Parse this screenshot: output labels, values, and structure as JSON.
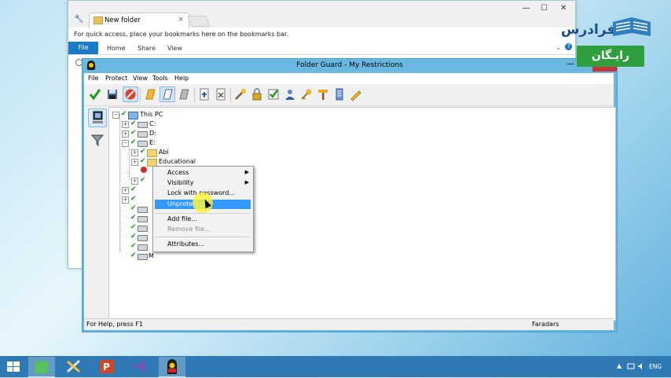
{
  "explorer": {
    "tab_label": "New folder",
    "tab_close": "×",
    "bookmark_bar_text": "For quick access, place your bookmarks here on the bookmarks bar.",
    "ribbon": {
      "file": "File",
      "tabs": [
        "Home",
        "Share",
        "View"
      ]
    },
    "controls": {
      "minimize": "—",
      "maximize": "☐",
      "close": "✕"
    }
  },
  "folder_guard": {
    "title": "Folder Guard - My Restrictions",
    "close": "✕",
    "menu": [
      "File",
      "Protect",
      "View",
      "Tools",
      "Help"
    ],
    "tree": {
      "root": "This PC",
      "drives": [
        "C:",
        "D:",
        "E:"
      ],
      "e_children": [
        "Abi",
        "Educational"
      ],
      "last_partial": "M"
    },
    "context_menu": {
      "items": [
        {
          "label": "Access",
          "submenu": true
        },
        {
          "label": "Visibility",
          "submenu": true
        },
        {
          "label": "Lock with password..."
        },
        {
          "label": "Unprotect..."
        },
        {
          "label": "Add file..."
        },
        {
          "label": "Remove file...",
          "disabled": true
        },
        {
          "label": "Attributes..."
        }
      ],
      "highlighted": "Unprotect..."
    },
    "status": {
      "help": "For Help, press F1",
      "user": "Faradars"
    }
  },
  "brand": {
    "name": "فرادرس",
    "tagline": "رایـگان",
    "accent": "#2e9e3f",
    "logo_color": "#1a4f8a"
  },
  "taskbar": {
    "apps": [
      "start-icon",
      "clover-icon",
      "tools-icon",
      "powerpoint-icon",
      "visual-studio-icon",
      "folder-guard-icon"
    ],
    "active_app": "folder-guard-icon",
    "language": "ENG"
  },
  "colors": {
    "titlebar": "#6ab7e0",
    "close_red": "#c7333a",
    "selection_blue": "#3399ff",
    "taskbar": "#2f7ab5"
  }
}
